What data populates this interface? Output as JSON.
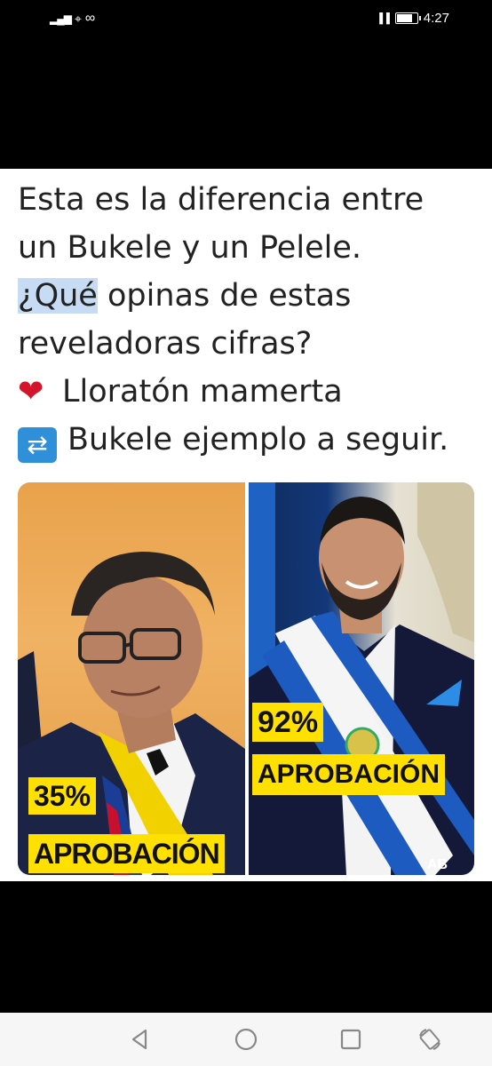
{
  "status_bar": {
    "signal": "▂▄▆",
    "wifi": "⌖",
    "voicemail": "∞",
    "vibrate": "▐▐",
    "battery_level": 0.8,
    "time": "4:27"
  },
  "post": {
    "lines": [
      "Esta es la diferencia entre",
      "un Bukele y un Pelele."
    ],
    "q_highlight": "¿Qué",
    "q_rest": " opinas de estas",
    "line4": "reveladoras cifras?",
    "option_heart": {
      "icon": "heart-icon",
      "label": "Lloratón mamerta"
    },
    "option_repeat": {
      "icon": "repeat-icon",
      "label": "Bukele ejemplo a seguir."
    }
  },
  "collage": {
    "left": {
      "percent": "35%",
      "label": "APROBACIÓN",
      "bg_color": "#e9a24b"
    },
    "right": {
      "percent": "92%",
      "label": "APROBACIÓN",
      "bg_color": "#13387a"
    },
    "watermark": "AB"
  },
  "nav": {
    "back": "back-icon",
    "home": "home-icon",
    "recents": "recents-icon",
    "rotate": "rotate-icon"
  }
}
